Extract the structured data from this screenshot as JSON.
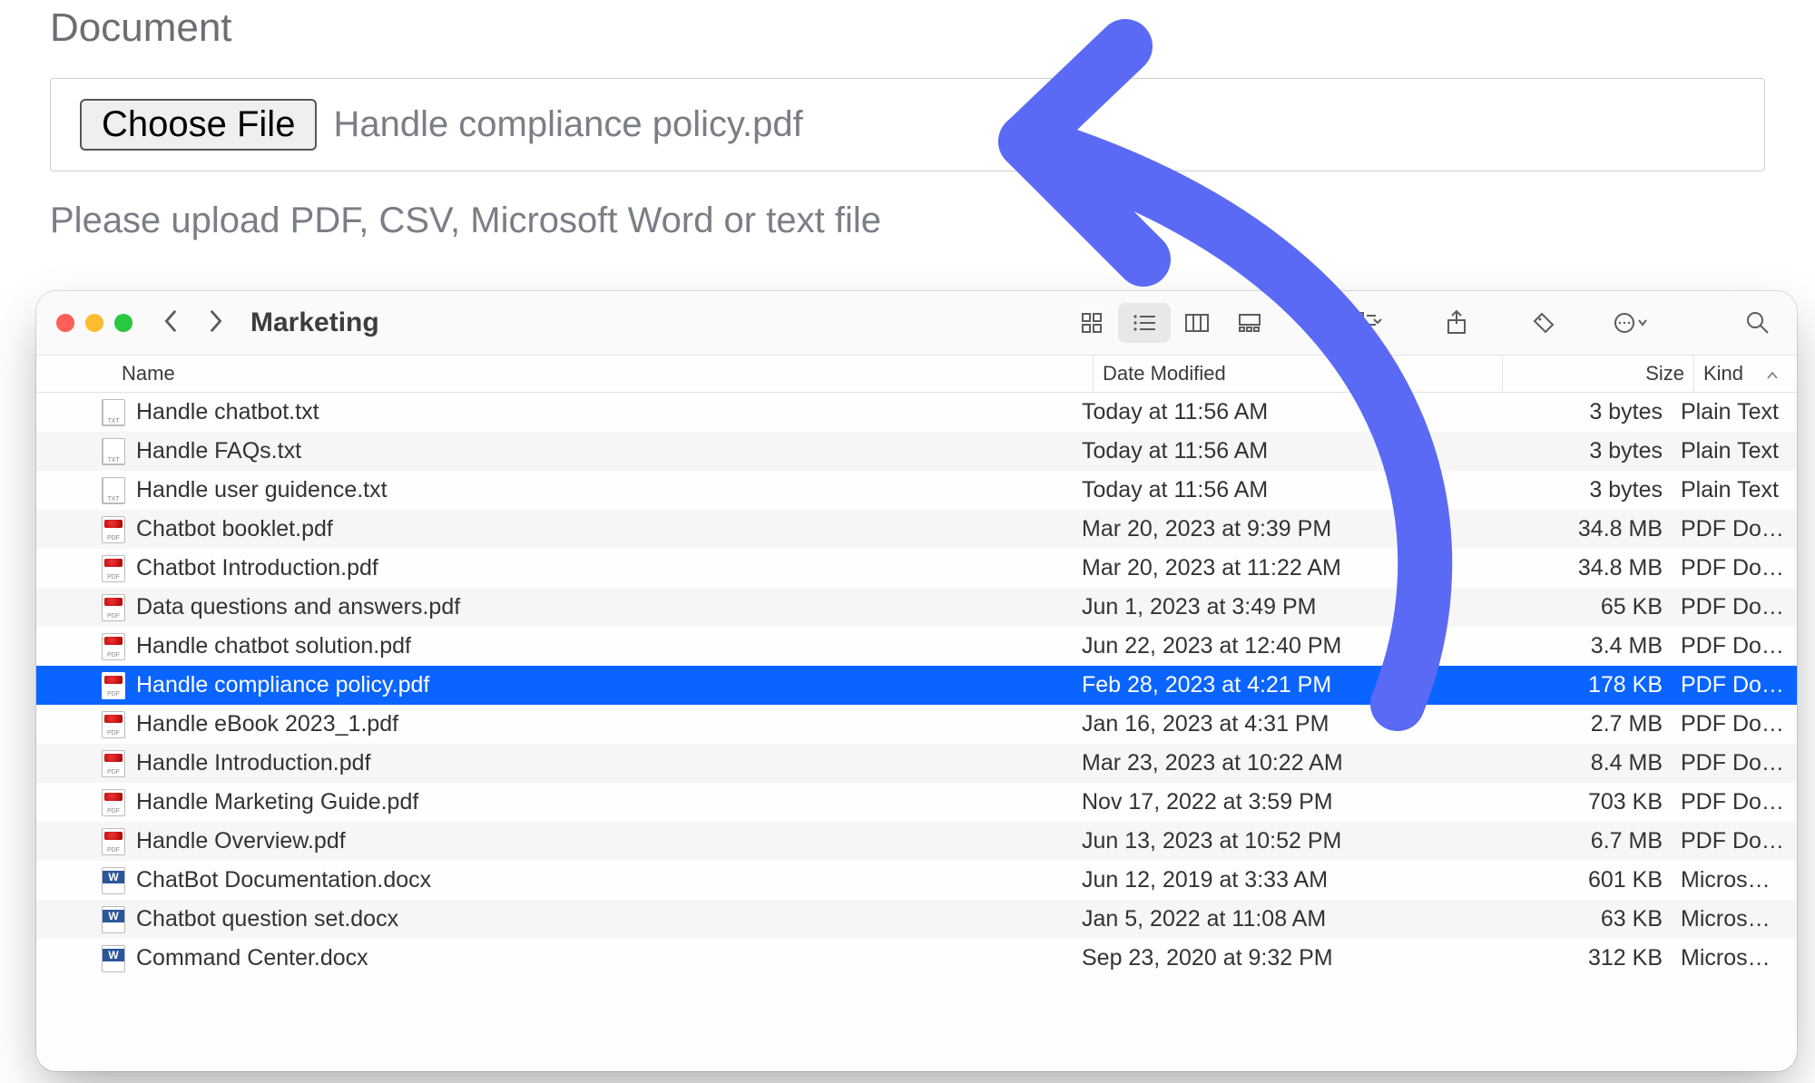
{
  "form": {
    "section_label": "Document",
    "button_label": "Choose File",
    "selected_file": "Handle compliance policy.pdf",
    "hint": "Please upload PDF, CSV, Microsoft Word or text file"
  },
  "finder": {
    "title": "Marketing",
    "columns": {
      "name": "Name",
      "date": "Date Modified",
      "size": "Size",
      "kind": "Kind"
    },
    "files": [
      {
        "icon": "txt",
        "name": "Handle chatbot.txt",
        "date": "Today at 11:56 AM",
        "size": "3 bytes",
        "kind": "Plain Text"
      },
      {
        "icon": "txt",
        "name": "Handle FAQs.txt",
        "date": "Today at 11:56 AM",
        "size": "3 bytes",
        "kind": "Plain Text"
      },
      {
        "icon": "txt",
        "name": "Handle user guidence.txt",
        "date": "Today at 11:56 AM",
        "size": "3 bytes",
        "kind": "Plain Text"
      },
      {
        "icon": "pdf",
        "name": "Chatbot booklet.pdf",
        "date": "Mar 20, 2023 at 9:39 PM",
        "size": "34.8 MB",
        "kind": "PDF Document"
      },
      {
        "icon": "pdf",
        "name": "Chatbot Introduction.pdf",
        "date": "Mar 20, 2023 at 11:22 AM",
        "size": "34.8 MB",
        "kind": "PDF Document"
      },
      {
        "icon": "pdf",
        "name": "Data questions and answers.pdf",
        "date": "Jun 1, 2023 at 3:49 PM",
        "size": "65 KB",
        "kind": "PDF Document"
      },
      {
        "icon": "pdf",
        "name": "Handle chatbot solution.pdf",
        "date": "Jun 22, 2023 at 12:40 PM",
        "size": "3.4 MB",
        "kind": "PDF Document"
      },
      {
        "icon": "pdf",
        "name": "Handle compliance policy.pdf",
        "date": "Feb 28, 2023 at 4:21 PM",
        "size": "178 KB",
        "kind": "PDF Document",
        "selected": true
      },
      {
        "icon": "pdf",
        "name": "Handle eBook 2023_1.pdf",
        "date": "Jan 16, 2023 at 4:31 PM",
        "size": "2.7 MB",
        "kind": "PDF Document"
      },
      {
        "icon": "pdf",
        "name": "Handle Introduction.pdf",
        "date": "Mar 23, 2023 at 10:22 AM",
        "size": "8.4 MB",
        "kind": "PDF Document"
      },
      {
        "icon": "pdf",
        "name": "Handle Marketing Guide.pdf",
        "date": "Nov 17, 2022 at 3:59 PM",
        "size": "703 KB",
        "kind": "PDF Document"
      },
      {
        "icon": "pdf",
        "name": "Handle Overview.pdf",
        "date": "Jun 13, 2023 at 10:52 PM",
        "size": "6.7 MB",
        "kind": "PDF Document"
      },
      {
        "icon": "doc",
        "name": "ChatBot Documentation.docx",
        "date": "Jun 12, 2019 at 3:33 AM",
        "size": "601 KB",
        "kind": "Micros…(.docx)"
      },
      {
        "icon": "doc",
        "name": "Chatbot question set.docx",
        "date": "Jan 5, 2022 at 11:08 AM",
        "size": "63 KB",
        "kind": "Micros…(.docx)"
      },
      {
        "icon": "doc",
        "name": "Command Center.docx",
        "date": "Sep 23, 2020 at 9:32 PM",
        "size": "312 KB",
        "kind": "Micros…(.docx)"
      }
    ]
  }
}
